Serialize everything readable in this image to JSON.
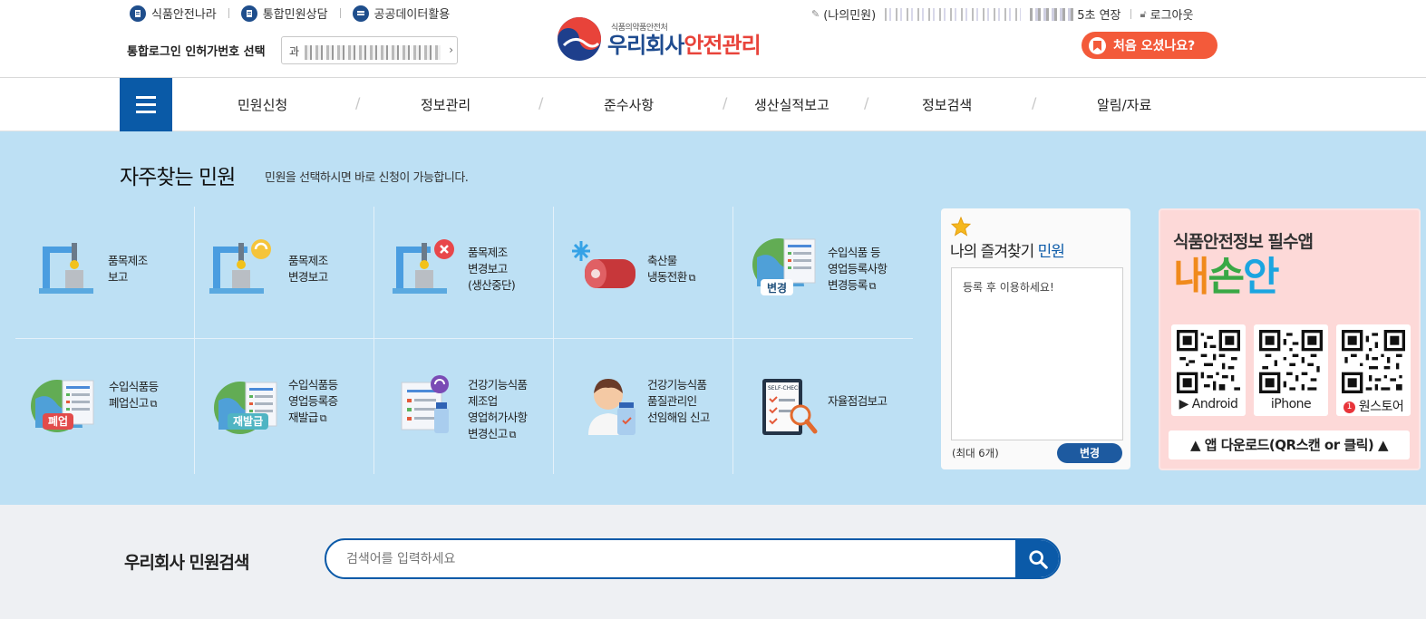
{
  "top_links": [
    {
      "label": "식품안전나라"
    },
    {
      "label": "통합민원상담"
    },
    {
      "label": "공공데이터활용"
    }
  ],
  "login": {
    "label": "통합로그인 인허가번호 선택",
    "select_value": "과"
  },
  "logo": {
    "sub": "식품의약품안전처",
    "main_blue": "우리회사",
    "main_red": "안전관리"
  },
  "user": {
    "my_petition": "(나의민원)",
    "extend": "5초 연장",
    "logout": "로그아웃"
  },
  "first_visit": "처음 오셨나요?",
  "nav": [
    "민원신청",
    "정보관리",
    "준수사항",
    "생산실적보고",
    "정보검색",
    "알림/자료"
  ],
  "section": {
    "title": "자주찾는 민원",
    "desc": "민원을 선택하시면 바로 신청이 가능합니다."
  },
  "tiles": [
    {
      "lines": [
        "품목제조",
        "보고"
      ],
      "icon": "factory-robot-icon"
    },
    {
      "lines": [
        "품목제조",
        "변경보고"
      ],
      "icon": "factory-robot-refresh-icon"
    },
    {
      "lines": [
        "품목제조",
        "변경보고",
        "(생산중단)"
      ],
      "icon": "factory-robot-stop-icon"
    },
    {
      "lines": [
        "축산물",
        "냉동전환"
      ],
      "external": true,
      "icon": "frozen-meat-icon"
    },
    {
      "lines": [
        "수입식품 등",
        "영업등록사항",
        "변경등록"
      ],
      "external": true,
      "badge": "변경",
      "badge_color": "#ffffff",
      "icon": "globe-document-icon"
    },
    {
      "lines": [
        "수입식품등",
        "폐업신고"
      ],
      "external": true,
      "badge": "폐업",
      "badge_color": "#e24b4b",
      "icon": "globe-document-icon"
    },
    {
      "lines": [
        "수입식품등",
        "영업등록증",
        "재발급"
      ],
      "external": true,
      "badge": "재발급",
      "badge_color": "#4fb4c3",
      "icon": "globe-document-icon"
    },
    {
      "lines": [
        "건강기능식품",
        "제조업",
        "영업허가사항",
        "변경신고"
      ],
      "external": true,
      "icon": "document-bottle-icon"
    },
    {
      "lines": [
        "건강기능식품",
        "품질관리인",
        "선임해임 신고"
      ],
      "icon": "pharmacist-icon"
    },
    {
      "lines": [
        "자율점검보고"
      ],
      "icon": "self-check-clipboard-icon"
    }
  ],
  "favorites": {
    "title_pre": "나의 즐겨찾기 ",
    "title_hl": "민원",
    "placeholder": "등록 후 이용하세요!",
    "max": "(최대 6개)",
    "change_btn": "변경"
  },
  "app": {
    "title": "식품안전정보 필수앱",
    "brand": [
      "내",
      "손",
      "안"
    ],
    "stores": [
      "Android",
      "iPhone",
      "원스토어"
    ],
    "download": "▲ 앱 다운로드(QR스캔 or 클릭) ▲"
  },
  "search": {
    "title": "우리회사 민원검색",
    "placeholder": "검색어를 입력하세요"
  },
  "colors": {
    "primary": "#0a5aa7",
    "accent": "#f35a3a",
    "section_bg": "#bde0f4"
  }
}
